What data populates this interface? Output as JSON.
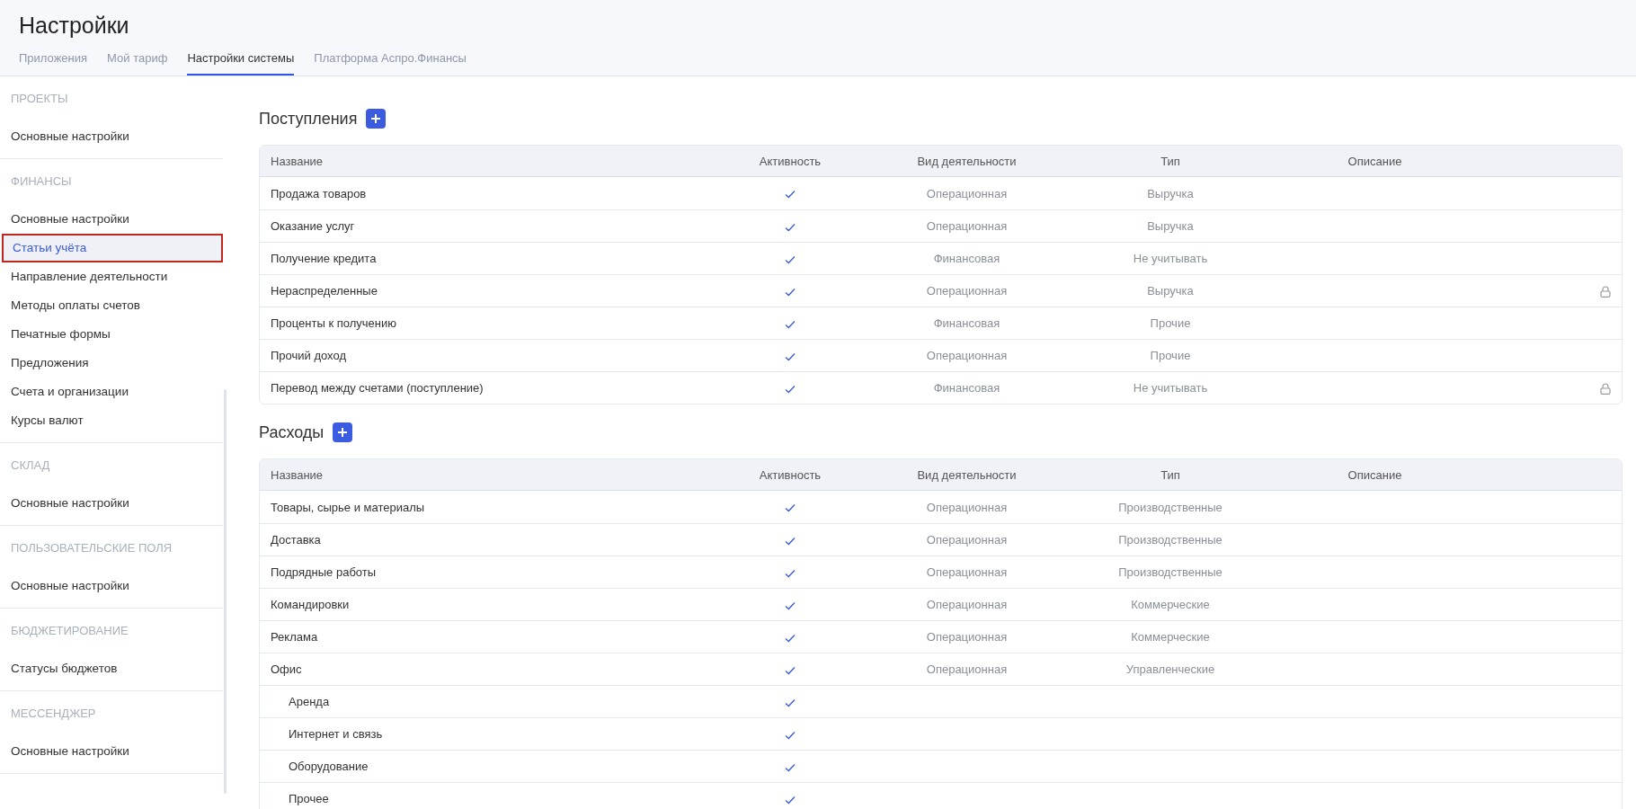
{
  "page": {
    "title": "Настройки"
  },
  "tabs": [
    {
      "label": "Приложения",
      "selected": false
    },
    {
      "label": "Мой тариф",
      "selected": false
    },
    {
      "label": "Настройки системы",
      "selected": true
    },
    {
      "label": "Платформа Аспро.Финансы",
      "selected": false
    }
  ],
  "sidebar": {
    "sections": [
      {
        "heading": "ПРОЕКТЫ",
        "items": [
          {
            "label": "Основные настройки",
            "selected": false
          }
        ]
      },
      {
        "heading": "ФИНАНСЫ",
        "items": [
          {
            "label": "Основные настройки",
            "selected": false
          },
          {
            "label": "Статьи учёта",
            "selected": true
          },
          {
            "label": "Направление деятельности",
            "selected": false
          },
          {
            "label": "Методы оплаты счетов",
            "selected": false
          },
          {
            "label": "Печатные формы",
            "selected": false
          },
          {
            "label": "Предложения",
            "selected": false
          },
          {
            "label": "Счета и организации",
            "selected": false
          },
          {
            "label": "Курсы валют",
            "selected": false
          }
        ]
      },
      {
        "heading": "СКЛАД",
        "items": [
          {
            "label": "Основные настройки",
            "selected": false
          }
        ]
      },
      {
        "heading": "ПОЛЬЗОВАТЕЛЬСКИЕ ПОЛЯ",
        "items": [
          {
            "label": "Основные настройки",
            "selected": false
          }
        ]
      },
      {
        "heading": "БЮДЖЕТИРОВАНИЕ",
        "items": [
          {
            "label": "Статусы бюджетов",
            "selected": false
          }
        ]
      },
      {
        "heading": "МЕССЕНДЖЕР",
        "items": [
          {
            "label": "Основные настройки",
            "selected": false
          }
        ]
      }
    ]
  },
  "tables": [
    {
      "title": "Поступления",
      "columns": [
        "Название",
        "Активность",
        "Вид деятельности",
        "Тип",
        "Описание"
      ],
      "rows": [
        {
          "name": "Продажа товаров",
          "active": true,
          "activity": "Операционная",
          "type": "Выручка",
          "locked": false
        },
        {
          "name": "Оказание услуг",
          "active": true,
          "activity": "Операционная",
          "type": "Выручка",
          "locked": false
        },
        {
          "name": "Получение кредита",
          "active": true,
          "activity": "Финансовая",
          "type": "Не учитывать",
          "locked": false
        },
        {
          "name": "Нераспределенные",
          "active": true,
          "activity": "Операционная",
          "type": "Выручка",
          "locked": true
        },
        {
          "name": "Проценты к получению",
          "active": true,
          "activity": "Финансовая",
          "type": "Прочие",
          "locked": false
        },
        {
          "name": "Прочий доход",
          "active": true,
          "activity": "Операционная",
          "type": "Прочие",
          "locked": false
        },
        {
          "name": "Перевод между счетами (поступление)",
          "active": true,
          "activity": "Финансовая",
          "type": "Не учитывать",
          "locked": true
        }
      ]
    },
    {
      "title": "Расходы",
      "columns": [
        "Название",
        "Активность",
        "Вид деятельности",
        "Тип",
        "Описание"
      ],
      "rows": [
        {
          "name": "Товары, сырье и материалы",
          "active": true,
          "activity": "Операционная",
          "type": "Производственные",
          "locked": false
        },
        {
          "name": "Доставка",
          "active": true,
          "activity": "Операционная",
          "type": "Производственные",
          "locked": false
        },
        {
          "name": "Подрядные работы",
          "active": true,
          "activity": "Операционная",
          "type": "Производственные",
          "locked": false
        },
        {
          "name": "Командировки",
          "active": true,
          "activity": "Операционная",
          "type": "Коммерческие",
          "locked": false
        },
        {
          "name": "Реклама",
          "active": true,
          "activity": "Операционная",
          "type": "Коммерческие",
          "locked": false
        },
        {
          "name": "Офис",
          "active": true,
          "activity": "Операционная",
          "type": "Управленческие",
          "locked": false,
          "children": [
            {
              "name": "Аренда",
              "active": true,
              "locked": false
            },
            {
              "name": "Интернет и связь",
              "active": true,
              "locked": false
            },
            {
              "name": "Оборудование",
              "active": true,
              "locked": false
            },
            {
              "name": "Прочее",
              "active": true,
              "locked": false
            }
          ]
        }
      ]
    }
  ]
}
